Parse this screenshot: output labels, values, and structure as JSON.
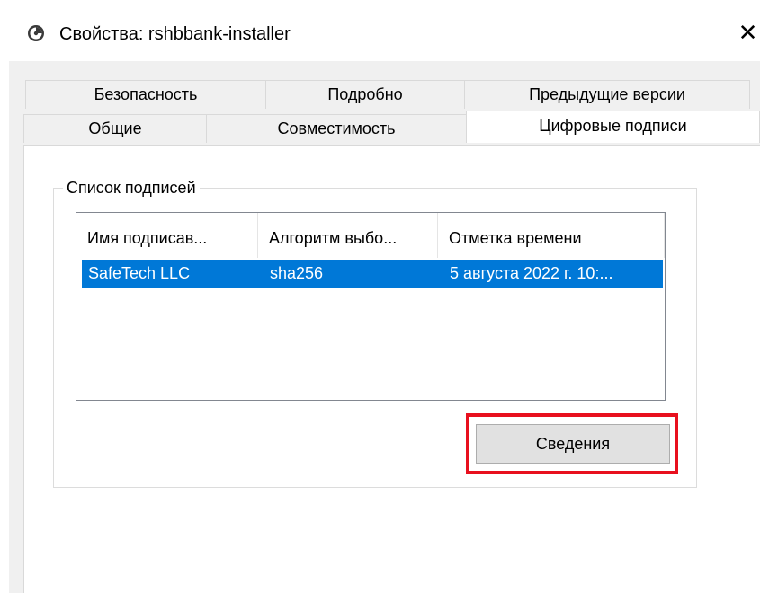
{
  "window": {
    "title": "Свойства: rshbbank-installer",
    "close_symbol": "✕",
    "app_icon": "properties-icon"
  },
  "tabs": {
    "row_back": [
      {
        "label": "Безопасность"
      },
      {
        "label": "Подробно"
      },
      {
        "label": "Предыдущие версии"
      }
    ],
    "row_front": [
      {
        "label": "Общие"
      },
      {
        "label": "Совместимость"
      },
      {
        "label": "Цифровые подписи"
      }
    ],
    "active": "Цифровые подписи"
  },
  "signature_list": {
    "group_label": "Список подписей",
    "columns": [
      "Имя подписав...",
      "Алгоритм выбо...",
      "Отметка времени"
    ],
    "rows": [
      {
        "signer": "SafeTech LLC",
        "algorithm": "sha256",
        "timestamp": "5 августа 2022 г. 10:...",
        "selected": true
      }
    ]
  },
  "buttons": {
    "details_label": "Сведения"
  },
  "colors": {
    "selection": "#0078d7",
    "highlight_frame": "#e8101e",
    "dialog_background": "#f0f0f0"
  }
}
